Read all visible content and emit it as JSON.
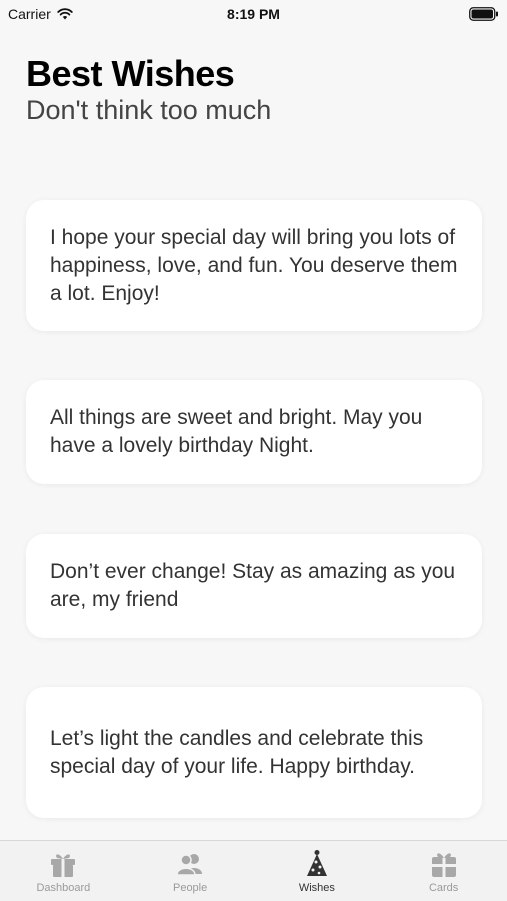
{
  "status_bar": {
    "carrier": "Carrier",
    "time": "8:19 PM"
  },
  "header": {
    "title": "Best Wishes",
    "subtitle": "Don't think too much"
  },
  "wishes": [
    {
      "text": "I hope your special day will bring you lots of happiness, love, and fun. You deserve them a lot. Enjoy!"
    },
    {
      "text": "All things are sweet and bright. May you have a lovely birthday Night."
    },
    {
      "text": "Don’t ever change! Stay as amazing as you are, my friend"
    },
    {
      "text": "Let’s light the candles and celebrate this special day of your life. Happy birthday."
    }
  ],
  "tab_bar": {
    "active": "Wishes",
    "tabs": [
      {
        "label": "Dashboard",
        "icon": "gift-icon"
      },
      {
        "label": "People",
        "icon": "people-icon"
      },
      {
        "label": "Wishes",
        "icon": "party-hat-icon"
      },
      {
        "label": "Cards",
        "icon": "gift-card-icon"
      }
    ]
  }
}
